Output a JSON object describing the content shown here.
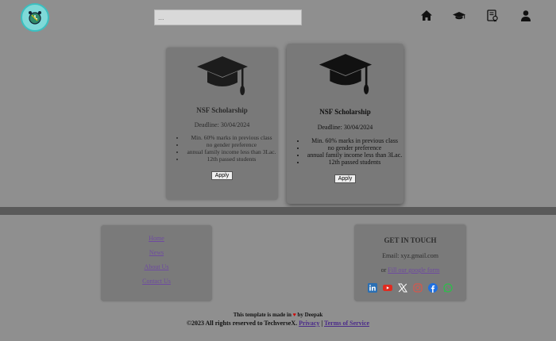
{
  "header": {
    "search": {
      "placeholder": "...",
      "value": ""
    },
    "nav": [
      "home-icon",
      "graduation-cap-icon",
      "certificate-icon",
      "user-icon"
    ]
  },
  "cards": [
    {
      "title": "NSF Scholarship",
      "deadline": "Deadline: 30/04/2024",
      "criteria": [
        "Min. 60% marks in previous class",
        "no gender preference",
        "annual family income less than 3Lac.",
        "12th passed students"
      ],
      "apply_label": "Apply"
    },
    {
      "title": "NSF Scholarship",
      "deadline": "Deadline: 30/04/2024",
      "criteria": [
        "Min. 60% marks in previous class",
        "no gender preference",
        "annual family income less than 3Lac.",
        "12th passed students"
      ],
      "apply_label": "Apply"
    }
  ],
  "footer": {
    "links": [
      "Home",
      "News",
      "About Us",
      "Contact Us"
    ],
    "contact": {
      "heading": "GET IN TOUCH",
      "email": "Email: xyz.gmail.com",
      "or_text": "or",
      "form_link": "Fill our google form",
      "social": [
        "linkedin-icon",
        "youtube-icon",
        "x-icon",
        "instagram-icon",
        "facebook-icon",
        "whatsapp-icon"
      ]
    },
    "credit_prefix": "This template is made in",
    "heart": "♥",
    "credit_suffix": "by Deepak",
    "copyright": "©2023 All rights reserved to TechverseX.",
    "privacy": "Privacy",
    "separator": "|",
    "terms": "Terms of Service"
  },
  "colors": {
    "background": "#8f8f8f",
    "card": "#797979",
    "link": "#6e4aa0",
    "heart": "#d10000"
  }
}
